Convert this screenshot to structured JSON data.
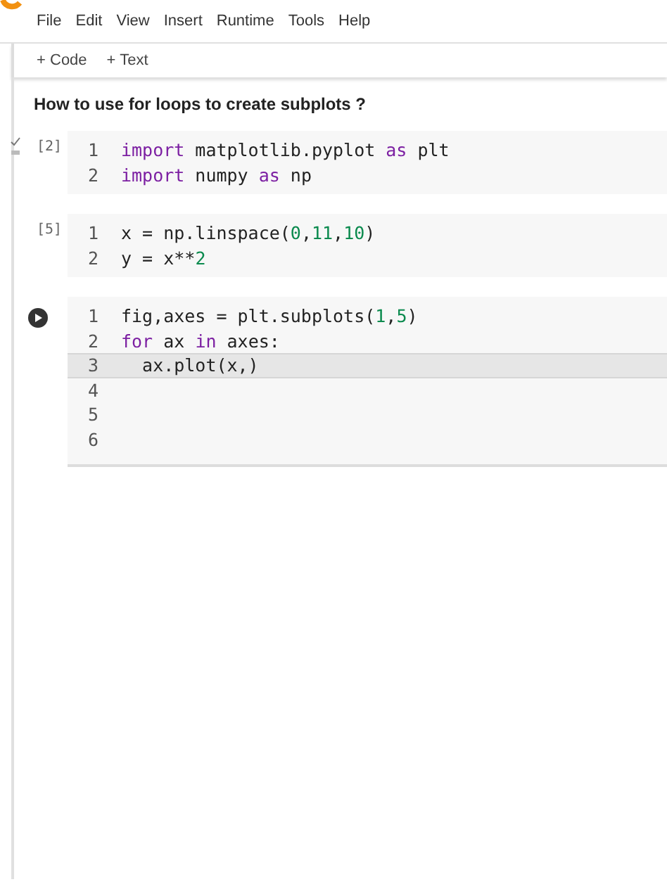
{
  "menu": [
    "File",
    "Edit",
    "View",
    "Insert",
    "Runtime",
    "Tools",
    "Help"
  ],
  "toolbar": [
    {
      "icon": "+",
      "label": "Code"
    },
    {
      "icon": "+",
      "label": "Text"
    }
  ],
  "text_cell": {
    "heading": "How to use for loops to create subplots ?"
  },
  "cells": [
    {
      "kind": "executed",
      "count": "[2]",
      "lines": [
        {
          "number": "1",
          "current": false,
          "tokens": [
            {
              "kind": "keyword",
              "text": "import"
            },
            {
              "kind": "plain",
              "text": " matplotlib.pyplot "
            },
            {
              "kind": "keyword",
              "text": "as"
            },
            {
              "kind": "plain",
              "text": " plt"
            }
          ]
        },
        {
          "number": "2",
          "current": false,
          "tokens": [
            {
              "kind": "keyword",
              "text": "import"
            },
            {
              "kind": "plain",
              "text": " numpy "
            },
            {
              "kind": "keyword",
              "text": "as"
            },
            {
              "kind": "plain",
              "text": " np"
            }
          ]
        }
      ]
    },
    {
      "kind": "count",
      "count": "[5]",
      "lines": [
        {
          "number": "1",
          "current": false,
          "tokens": [
            {
              "kind": "plain",
              "text": "x = np.linspace("
            },
            {
              "kind": "number",
              "text": "0"
            },
            {
              "kind": "plain",
              "text": ","
            },
            {
              "kind": "number",
              "text": "11"
            },
            {
              "kind": "plain",
              "text": ","
            },
            {
              "kind": "number",
              "text": "10"
            },
            {
              "kind": "plain",
              "text": ")"
            }
          ]
        },
        {
          "number": "2",
          "current": false,
          "tokens": [
            {
              "kind": "plain",
              "text": "y = x**"
            },
            {
              "kind": "number",
              "text": "2"
            }
          ]
        }
      ]
    },
    {
      "kind": "run",
      "lines": [
        {
          "number": "1",
          "current": false,
          "tokens": [
            {
              "kind": "plain",
              "text": "fig,axes = plt.subplots("
            },
            {
              "kind": "number",
              "text": "1"
            },
            {
              "kind": "plain",
              "text": ","
            },
            {
              "kind": "number",
              "text": "5"
            },
            {
              "kind": "plain",
              "text": ")"
            }
          ]
        },
        {
          "number": "2",
          "current": false,
          "tokens": [
            {
              "kind": "keyword",
              "text": "for"
            },
            {
              "kind": "plain",
              "text": " ax "
            },
            {
              "kind": "keyword",
              "text": "in"
            },
            {
              "kind": "plain",
              "text": " axes:"
            }
          ]
        },
        {
          "number": "3",
          "current": true,
          "tokens": [
            {
              "kind": "plain",
              "text": "  ax.plot(x,)"
            }
          ]
        },
        {
          "number": "4",
          "current": false
        },
        {
          "number": "5",
          "current": false
        },
        {
          "number": "6",
          "current": false
        }
      ]
    }
  ]
}
